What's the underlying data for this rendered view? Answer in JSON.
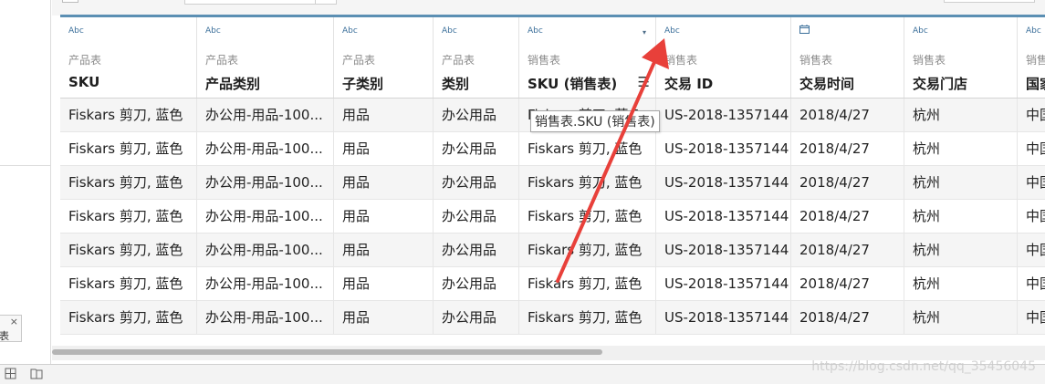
{
  "columns": [
    {
      "type": "Abc",
      "source": "产品表",
      "name": "SKU"
    },
    {
      "type": "Abc",
      "source": "产品表",
      "name": "产品类别"
    },
    {
      "type": "Abc",
      "source": "产品表",
      "name": "子类别"
    },
    {
      "type": "Abc",
      "source": "产品表",
      "name": "类别"
    },
    {
      "type": "Abc",
      "source": "销售表",
      "name": "SKU (销售表)"
    },
    {
      "type": "Abc",
      "source": "销售表",
      "name": "交易 ID"
    },
    {
      "type": "calendar-icon",
      "source": "销售表",
      "name": "交易时间"
    },
    {
      "type": "Abc",
      "source": "销售表",
      "name": "交易门店"
    },
    {
      "type": "Abc",
      "source": "销售表",
      "name": "国家"
    }
  ],
  "header_icons": {
    "sort_caret": "▾",
    "column_menu": "☰"
  },
  "rows": [
    [
      "Fiskars 剪刀, 蓝色",
      "办公用-用品-100...",
      "用品",
      "办公用品",
      "Fiskars 剪刀, 蓝色",
      "US-2018-1357144",
      "2018/4/27",
      "杭州",
      "中国"
    ],
    [
      "Fiskars 剪刀, 蓝色",
      "办公用-用品-100...",
      "用品",
      "办公用品",
      "Fiskars 剪刀, 蓝色",
      "US-2018-1357144",
      "2018/4/27",
      "杭州",
      "中国"
    ],
    [
      "Fiskars 剪刀, 蓝色",
      "办公用-用品-100...",
      "用品",
      "办公用品",
      "Fiskars 剪刀, 蓝色",
      "US-2018-1357144",
      "2018/4/27",
      "杭州",
      "中国"
    ],
    [
      "Fiskars 剪刀, 蓝色",
      "办公用-用品-100...",
      "用品",
      "办公用品",
      "Fiskars 剪刀, 蓝色",
      "US-2018-1357144",
      "2018/4/27",
      "杭州",
      "中国"
    ],
    [
      "Fiskars 剪刀, 蓝色",
      "办公用-用品-100...",
      "用品",
      "办公用品",
      "Fiskars 剪刀, 蓝色",
      "US-2018-1357144",
      "2018/4/27",
      "杭州",
      "中国"
    ],
    [
      "Fiskars 剪刀, 蓝色",
      "办公用-用品-100...",
      "用品",
      "办公用品",
      "Fiskars 剪刀, 蓝色",
      "US-2018-1357144",
      "2018/4/27",
      "杭州",
      "中国"
    ],
    [
      "Fiskars 剪刀, 蓝色",
      "办公用-用品-100...",
      "用品",
      "办公用品",
      "Fiskars 剪刀, 蓝色",
      "US-2018-1357144",
      "2018/4/27",
      "杭州",
      "中国"
    ]
  ],
  "tooltip": "销售表.SKU (销售表)",
  "left_panel": {
    "chip_close": "×",
    "chip_label": "表"
  },
  "bottom_icons": [
    "sheet-grid-icon",
    "sheet-book-icon"
  ],
  "watermark": "https://blog.csdn.net/qq_35456045",
  "colors": {
    "accent": "#5b8fb3",
    "type_label": "#3b6f9a",
    "arrow": "#e8403a"
  }
}
